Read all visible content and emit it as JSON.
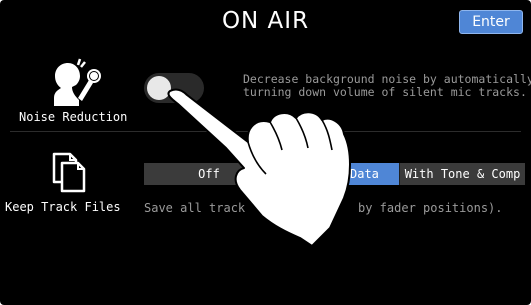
{
  "header": {
    "title": "ON AIR",
    "enter_label": "Enter"
  },
  "noise_reduction": {
    "label": "Noise Reduction",
    "icon": "mic-icon",
    "toggle_on": false,
    "description": [
      "Decrease background noise by automatically",
      "turning down volume of silent mic tracks."
    ]
  },
  "keep_track_files": {
    "label": "Keep Track Files",
    "icon": "files-icon",
    "options": [
      "Off",
      "Data",
      "With Tone & Comp"
    ],
    "selected": "Data",
    "description_visible": [
      "Save all track",
      "by fader positions)."
    ]
  },
  "colors": {
    "accent": "#4f86d6",
    "background": "#000000",
    "segment_inactive": "#3b3b3b"
  }
}
